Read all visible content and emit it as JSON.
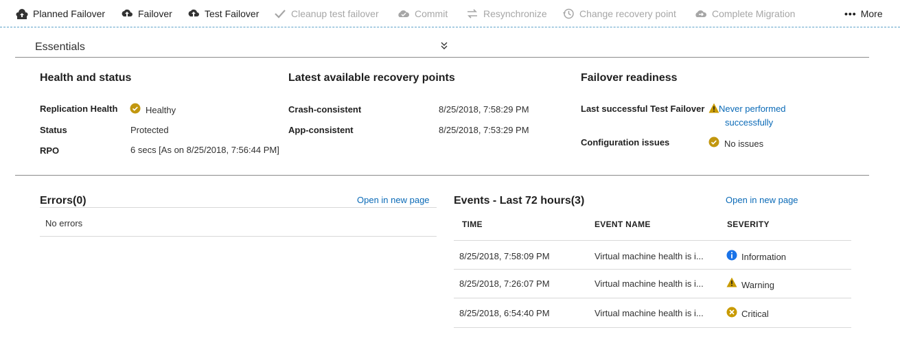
{
  "toolbar": {
    "planned_failover": "Planned Failover",
    "failover": "Failover",
    "test_failover": "Test Failover",
    "cleanup_test_failover": "Cleanup test failover",
    "commit": "Commit",
    "resynchronize": "Resynchronize",
    "change_recovery_point": "Change recovery point",
    "complete_migration": "Complete Migration",
    "more": "More"
  },
  "essentials": {
    "title": "Essentials"
  },
  "health": {
    "heading": "Health and status",
    "replication_health_label": "Replication Health",
    "replication_health_value": "Healthy",
    "status_label": "Status",
    "status_value": "Protected",
    "rpo_label": "RPO",
    "rpo_value": "6 secs [As on 8/25/2018, 7:56:44 PM]"
  },
  "recovery_points": {
    "heading": "Latest available recovery points",
    "crash_label": "Crash-consistent",
    "crash_value": "8/25/2018, 7:58:29 PM",
    "app_label": "App-consistent",
    "app_value": "8/25/2018, 7:53:29 PM"
  },
  "failover_readiness": {
    "heading": "Failover readiness",
    "last_test_label": "Last successful Test Failover",
    "last_test_value_line1": "Never performed",
    "last_test_value_line2": "successfully",
    "config_label": "Configuration issues",
    "config_value": "No issues"
  },
  "errors": {
    "heading": "Errors(0)",
    "open_link": "Open in new page",
    "empty_text": "No errors"
  },
  "events": {
    "heading": "Events - Last 72 hours(3)",
    "open_link": "Open in new page",
    "columns": [
      "TIME",
      "EVENT NAME",
      "SEVERITY"
    ],
    "rows": [
      {
        "time": "8/25/2018, 7:58:09 PM",
        "name": "Virtual machine health is i...",
        "severity": "Information",
        "severity_icon": "info-icon"
      },
      {
        "time": "8/25/2018, 7:26:07 PM",
        "name": "Virtual machine health is i...",
        "severity": "Warning",
        "severity_icon": "warning-icon"
      },
      {
        "time": "8/25/2018, 6:54:40 PM",
        "name": "Virtual machine health is i...",
        "severity": "Critical",
        "severity_icon": "critical-icon"
      }
    ]
  },
  "colors": {
    "link": "#0a6ab7",
    "healthy": "#b8860b",
    "info": "#1a73e8",
    "warning": "#c89a00",
    "critical": "#c89a00"
  }
}
